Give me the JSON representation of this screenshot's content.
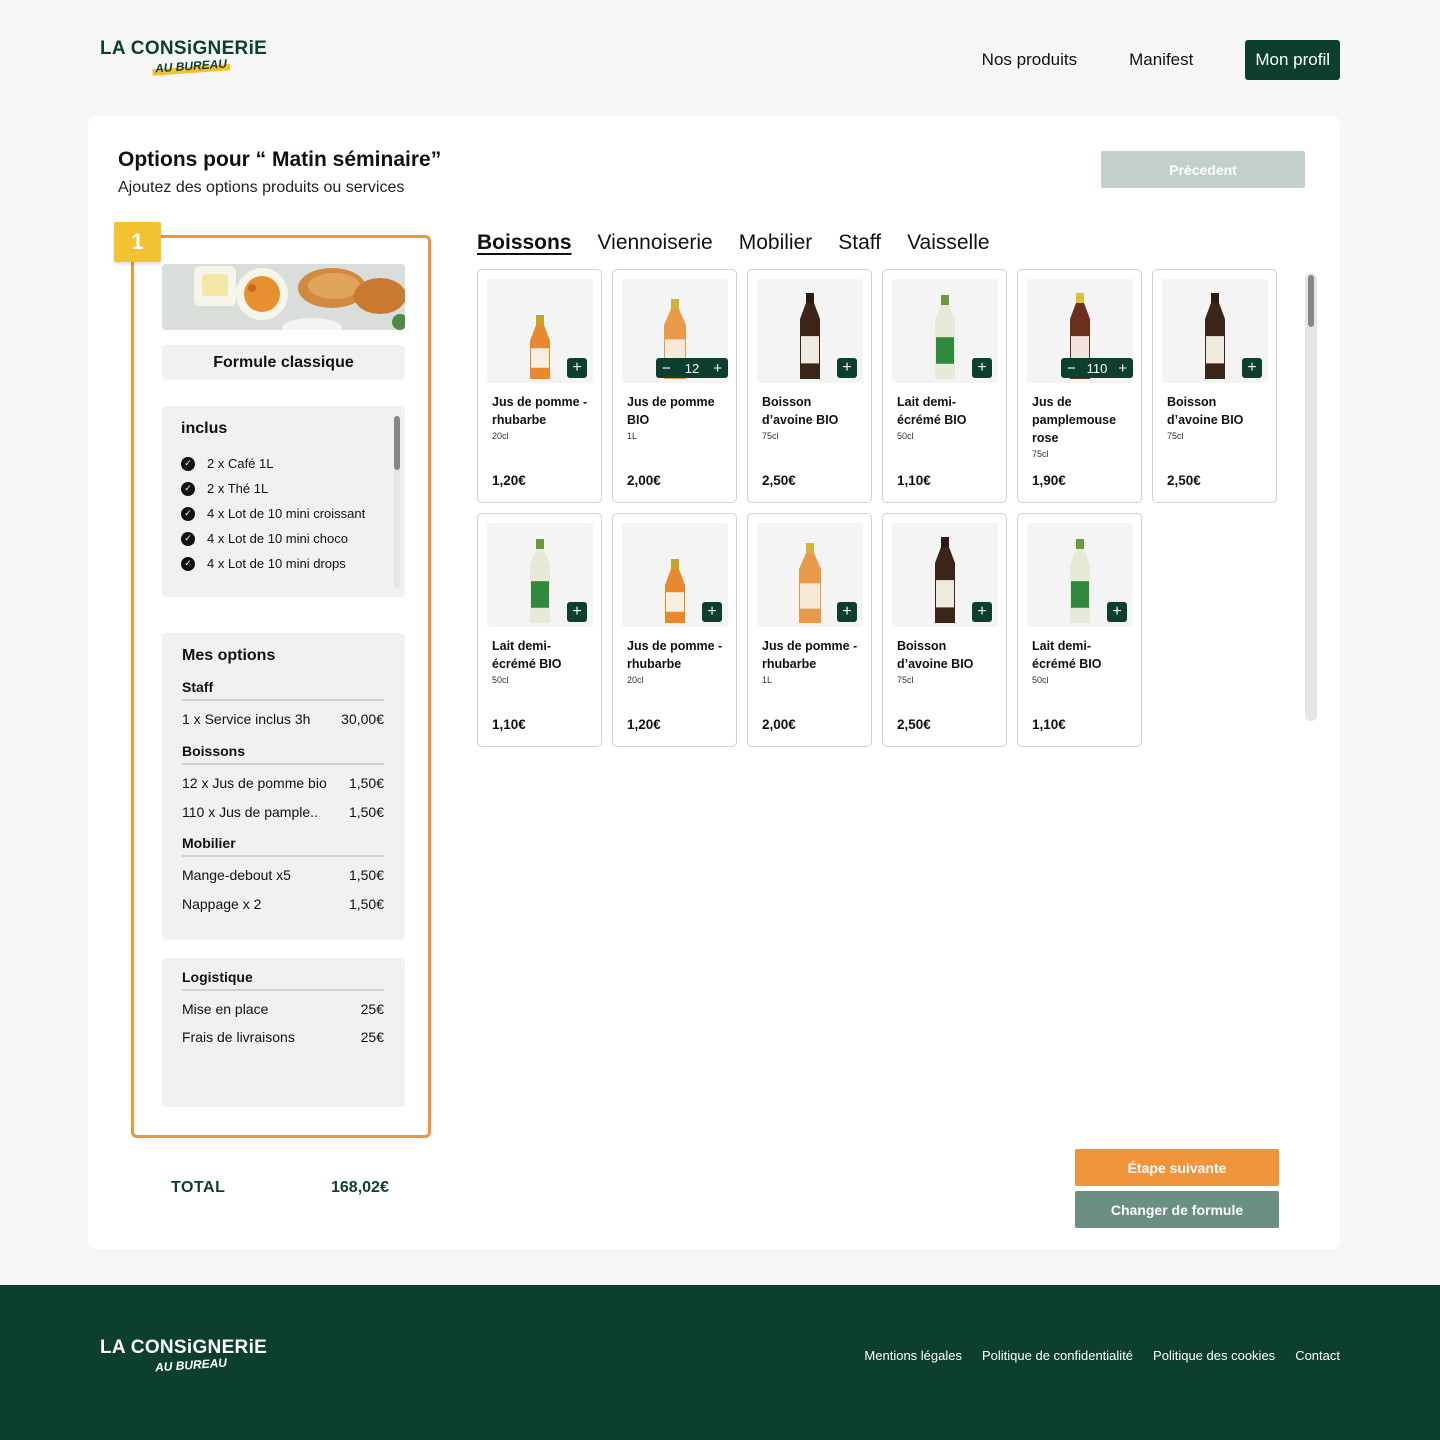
{
  "brand": {
    "name": "LA CONSiGNERiE",
    "sub": "AU BUREAU"
  },
  "nav": {
    "products": "Nos produits",
    "manifest": "Manifest",
    "profile": "Mon profil"
  },
  "page": {
    "title": "Options pour “ Matin séminaire”",
    "subtitle": "Ajoutez des options produits ou services",
    "prev_button": "Précedent"
  },
  "formule": {
    "step": "1",
    "name": "Formule classique",
    "inclus_title": "inclus",
    "inclus": [
      "2 x Café 1L",
      "2 x Thé 1L",
      "4 x Lot de 10 mini croissant",
      "4 x Lot de 10 mini choco",
      "4 x Lot de 10 mini drops"
    ]
  },
  "options": {
    "title": "Mes options",
    "staff_label": "Staff",
    "staff": [
      {
        "label": "1 x Service inclus 3h",
        "price": "30,00€"
      }
    ],
    "boissons_label": "Boissons",
    "boissons": [
      {
        "label": "12 x Jus de pomme bio",
        "price": "1,50€"
      },
      {
        "label": "110 x Jus de pample..",
        "price": "1,50€"
      }
    ],
    "mobilier_label": "Mobilier",
    "mobilier": [
      {
        "label": "Mange-debout x5",
        "price": "1,50€"
      },
      {
        "label": "Nappage x 2",
        "price": "1,50€"
      }
    ]
  },
  "logistique": {
    "title": "Logistique",
    "rows": [
      {
        "label": "Mise en place",
        "price": "25€"
      },
      {
        "label": "Frais de livraisons",
        "price": "25€"
      }
    ]
  },
  "total": {
    "label": "TOTAL",
    "value": "168,02€"
  },
  "tabs": [
    "Boissons",
    "Viennoiserie",
    "Mobilier",
    "Staff",
    "Vaisselle"
  ],
  "products": [
    {
      "name": "Jus de pomme - rhubarbe",
      "volume": "20cl",
      "price": "1,20€",
      "qty": "",
      "icon": "juice-bottle-small"
    },
    {
      "name": "Jus de pomme BIO",
      "volume": "1L",
      "price": "2,00€",
      "qty": "12",
      "icon": "juice-bottle-large"
    },
    {
      "name": "Boisson d’avoine BIO",
      "volume": "75cl",
      "price": "2,50€",
      "qty": "",
      "icon": "oat-drink-bottle"
    },
    {
      "name": "Lait demi-écrémé BIO",
      "volume": "50cl",
      "price": "1,10€",
      "qty": "",
      "icon": "milk-bottle"
    },
    {
      "name": "Jus de pamplemouse rose",
      "volume": "75cl",
      "price": "1,90€",
      "qty": "110",
      "icon": "grapefruit-bottle"
    },
    {
      "name": "Boisson d’avoine BIO",
      "volume": "75cl",
      "price": "2,50€",
      "qty": "",
      "icon": "oat-drink-bottle"
    },
    {
      "name": "Lait demi-écrémé BIO",
      "volume": "50cl",
      "price": "1,10€",
      "qty": "",
      "icon": "milk-bottle"
    },
    {
      "name": "Jus de pomme - rhubarbe",
      "volume": "20cl",
      "price": "1,20€",
      "qty": "",
      "icon": "juice-bottle-small"
    },
    {
      "name": "Jus de pomme - rhubarbe",
      "volume": "1L",
      "price": "2,00€",
      "qty": "",
      "icon": "juice-bottle-large"
    },
    {
      "name": "Boisson d’avoine BIO",
      "volume": "75cl",
      "price": "2,50€",
      "qty": "",
      "icon": "oat-drink-bottle"
    },
    {
      "name": "Lait demi-écrémé BIO",
      "volume": "50cl",
      "price": "1,10€",
      "qty": "",
      "icon": "milk-bottle"
    }
  ],
  "buttons": {
    "next": "Étape suivante",
    "change": "Changer de formule"
  },
  "footer": {
    "links": [
      "Mentions légales",
      "Politique de confidentialité",
      "Politique des cookies",
      "Contact"
    ]
  },
  "colors": {
    "brand_green": "#0c3f2d",
    "accent_orange": "#f0953b",
    "badge_yellow": "#f2c230",
    "muted_green": "#6a9081"
  }
}
